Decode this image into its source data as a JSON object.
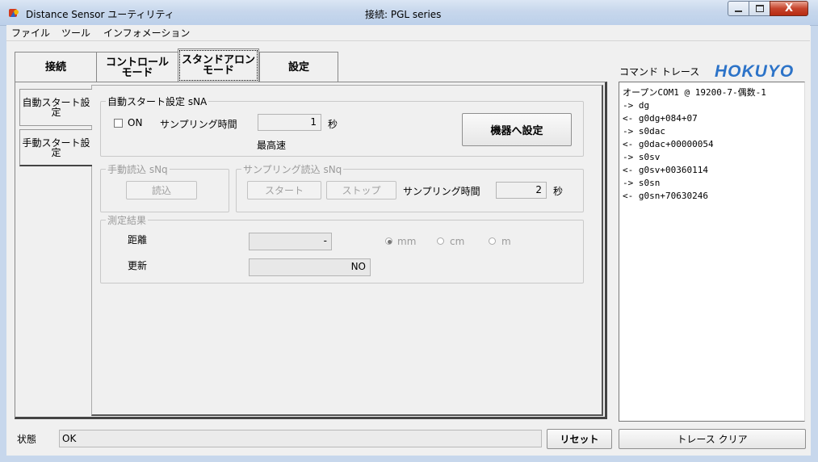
{
  "window": {
    "title": "Distance Sensor ユーティリティ",
    "connection": "接続: PGL series",
    "close_glyph": "X"
  },
  "menu": [
    "ファイル",
    "ツール",
    "インフォメーション"
  ],
  "top_tabs": [
    "接続",
    "コントロール\nモード",
    "スタンドアロン\nモード",
    "設定"
  ],
  "side_tabs": [
    "自動スタート設\n定",
    "手動スタート設\n定"
  ],
  "auto_start": {
    "legend": "自動スタート設定 sNA",
    "on_label": "ON",
    "sampling_label": "サンプリング時間",
    "sampling_value": "1",
    "unit": "秒",
    "fastest": "最高速",
    "apply_button": "機器へ設定"
  },
  "manual_read": {
    "legend": "手動読込 sNq",
    "read_button": "読込"
  },
  "sampling_read": {
    "legend": "サンプリング読込 sNq",
    "start_button": "スタート",
    "stop_button": "ストップ",
    "sampling_label": "サンプリング時間",
    "sampling_value": "2",
    "unit": "秒"
  },
  "result": {
    "legend": "測定結果",
    "distance_label": "距離",
    "distance_value": "-",
    "update_label": "更新",
    "update_value": "NO",
    "units": [
      "mm",
      "cm",
      "m"
    ],
    "selected_unit": "mm"
  },
  "trace": {
    "title": "コマンド トレース",
    "logo": "HOKUYO",
    "lines": [
      "オープンCOM1 @ 19200-7-偶数-1",
      "-> dg",
      "<- g0dg+084+07",
      "-> s0dac",
      "<- g0dac+00000054",
      "-> s0sv",
      "<- g0sv+00360114",
      "-> s0sn",
      "<- g0sn+70630246"
    ],
    "clear_button": "トレース クリア"
  },
  "status": {
    "label": "状態",
    "value": "OK",
    "reset_button": "リセット"
  }
}
